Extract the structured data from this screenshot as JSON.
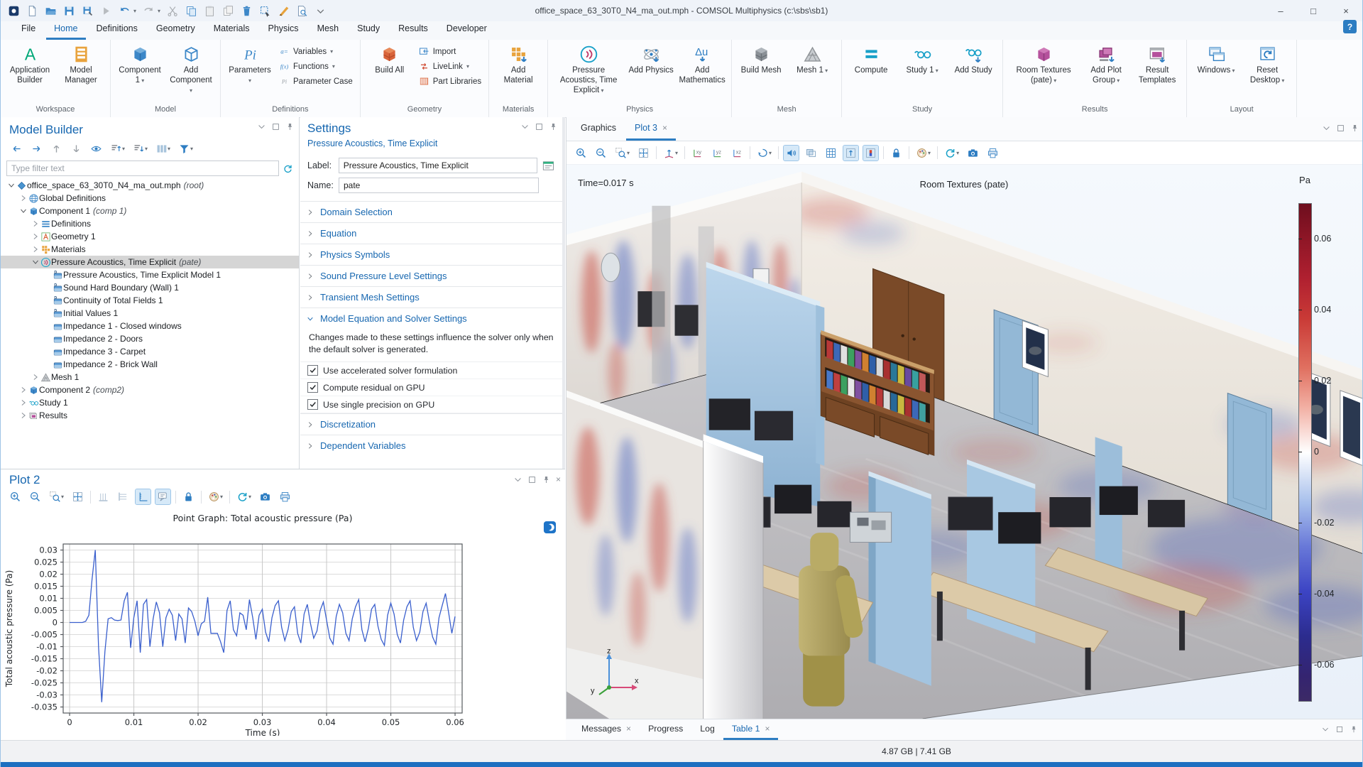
{
  "window": {
    "title": "office_space_63_30T0_N4_ma_out.mph - COMSOL Multiphysics (c:\\sbs\\sb1)",
    "controls": {
      "minimize": "–",
      "maximize": "□",
      "close": "×"
    },
    "quick_access_icons": [
      "app-logo",
      "new-doc",
      "open",
      "save",
      "save-as",
      "run",
      "undo",
      "redo",
      "cut",
      "copy",
      "paste",
      "duplicate",
      "delete",
      "select",
      "preview",
      "doc-search",
      "chev"
    ]
  },
  "menubar": {
    "items": [
      "File",
      "Home",
      "Definitions",
      "Geometry",
      "Materials",
      "Physics",
      "Mesh",
      "Study",
      "Results",
      "Developer"
    ],
    "active": "Home",
    "help_label": "?"
  },
  "ribbon": {
    "groups": [
      {
        "label": "Workspace",
        "big": [
          {
            "label": "Application Builder",
            "icon": "app-builder"
          },
          {
            "label": "Model Manager",
            "icon": "model-manager"
          }
        ]
      },
      {
        "label": "Model",
        "big": [
          {
            "label": "Component 1",
            "icon": "component",
            "dd": true
          },
          {
            "label": "Add Component",
            "icon": "add-component",
            "dd": true
          }
        ]
      },
      {
        "label": "Definitions",
        "big": [
          {
            "label": "Parameters",
            "icon": "parameters",
            "dd": true
          }
        ],
        "stack": [
          {
            "label": "Variables",
            "icon": "variables",
            "dd": true
          },
          {
            "label": "Functions",
            "icon": "functions",
            "dd": true
          },
          {
            "label": "Parameter Case",
            "icon": "param-case"
          }
        ]
      },
      {
        "label": "Geometry",
        "big": [
          {
            "label": "Build All",
            "icon": "build-all"
          }
        ],
        "stack": [
          {
            "label": "Import",
            "icon": "import"
          },
          {
            "label": "LiveLink",
            "icon": "livelink",
            "dd": true
          },
          {
            "label": "Part Libraries",
            "icon": "part-lib"
          }
        ]
      },
      {
        "label": "Materials",
        "big": [
          {
            "label": "Add Material",
            "icon": "add-material"
          }
        ]
      },
      {
        "label": "Physics",
        "big": [
          {
            "label": "Pressure Acoustics, Time Explicit",
            "icon": "acoustics",
            "dd": true,
            "wide": true
          },
          {
            "label": "Add Physics",
            "icon": "add-physics"
          },
          {
            "label": "Add Mathematics",
            "icon": "add-math"
          }
        ]
      },
      {
        "label": "Mesh",
        "big": [
          {
            "label": "Build Mesh",
            "icon": "build-mesh"
          },
          {
            "label": "Mesh 1",
            "icon": "mesh-node",
            "dd": true
          }
        ]
      },
      {
        "label": "Study",
        "big": [
          {
            "label": "Compute",
            "icon": "compute"
          },
          {
            "label": "Study 1",
            "icon": "study",
            "dd": true
          },
          {
            "label": "Add Study",
            "icon": "add-study"
          }
        ]
      },
      {
        "label": "Results",
        "big": [
          {
            "label": "Room Textures (pate)",
            "icon": "room-tex",
            "dd": true,
            "wide": true
          },
          {
            "label": "Add Plot Group",
            "icon": "add-plot",
            "dd": true
          },
          {
            "label": "Result Templates",
            "icon": "result-templates"
          }
        ]
      },
      {
        "label": "Layout",
        "big": [
          {
            "label": "Windows",
            "icon": "windows",
            "dd": true
          },
          {
            "label": "Reset Desktop",
            "icon": "reset-desktop",
            "dd": true
          }
        ]
      }
    ]
  },
  "model_builder": {
    "title": "Model Builder",
    "toolbar": [
      {
        "icon": "arrow-left"
      },
      {
        "icon": "arrow-right"
      },
      {
        "icon": "arrow-up"
      },
      {
        "icon": "arrow-down"
      },
      {
        "icon": "show"
      },
      {
        "icon": "collapse-list",
        "dd": true
      },
      {
        "icon": "expand-list",
        "dd": true
      },
      {
        "icon": "columns",
        "dd": true
      },
      {
        "icon": "filter",
        "dd": true
      }
    ],
    "filter_placeholder": "Type filter text",
    "tree": [
      {
        "depth": 0,
        "arrow": "down",
        "icon": "root-model",
        "label": "office_space_63_30T0_N4_ma_out.mph",
        "suffix": "(root)"
      },
      {
        "depth": 1,
        "arrow": "right",
        "icon": "global-definitions",
        "label": "Global Definitions"
      },
      {
        "depth": 1,
        "arrow": "down",
        "icon": "component-node",
        "label": "Component 1",
        "suffix": "(comp 1)"
      },
      {
        "depth": 2,
        "arrow": "right",
        "icon": "definitions-node",
        "label": "Definitions"
      },
      {
        "depth": 2,
        "arrow": "right",
        "icon": "geometry-node",
        "label": "Geometry 1"
      },
      {
        "depth": 2,
        "arrow": "right",
        "icon": "materials-node",
        "label": "Materials"
      },
      {
        "depth": 2,
        "arrow": "down",
        "icon": "acoustics-node",
        "label": "Pressure Acoustics, Time Explicit",
        "suffix": "(pate)",
        "selected": true
      },
      {
        "depth": 3,
        "arrow": "none",
        "icon": "d-boundary",
        "label": "Pressure Acoustics, Time Explicit Model 1"
      },
      {
        "depth": 3,
        "arrow": "none",
        "icon": "d-boundary",
        "label": "Sound Hard Boundary (Wall) 1"
      },
      {
        "depth": 3,
        "arrow": "none",
        "icon": "d-boundary",
        "label": "Continuity of Total Fields 1"
      },
      {
        "depth": 3,
        "arrow": "none",
        "icon": "d-boundary",
        "label": "Initial Values 1"
      },
      {
        "depth": 3,
        "arrow": "none",
        "icon": "boundary",
        "label": "Impedance 1 - Closed windows"
      },
      {
        "depth": 3,
        "arrow": "none",
        "icon": "boundary",
        "label": "Impedance 2 - Doors"
      },
      {
        "depth": 3,
        "arrow": "none",
        "icon": "boundary",
        "label": "Impedance 3 - Carpet"
      },
      {
        "depth": 3,
        "arrow": "none",
        "icon": "boundary",
        "label": "Impedance 2 - Brick Wall"
      },
      {
        "depth": 2,
        "arrow": "right",
        "icon": "mesh-node",
        "label": "Mesh 1"
      },
      {
        "depth": 1,
        "arrow": "right",
        "icon": "component-node",
        "label": "Component 2",
        "suffix": "(comp2)"
      },
      {
        "depth": 1,
        "arrow": "right",
        "icon": "study",
        "label": "Study 1"
      },
      {
        "depth": 1,
        "arrow": "right",
        "icon": "results-node",
        "label": "Results"
      }
    ]
  },
  "settings": {
    "title": "Settings",
    "subtitle": "Pressure Acoustics, Time Explicit",
    "label_caption": "Label:",
    "label_value": "Pressure Acoustics, Time Explicit",
    "name_caption": "Name:",
    "name_value": "pate",
    "sections": [
      {
        "label": "Domain Selection"
      },
      {
        "label": "Equation"
      },
      {
        "label": "Physics Symbols"
      },
      {
        "label": "Sound Pressure Level Settings"
      },
      {
        "label": "Transient Mesh Settings"
      },
      {
        "label": "Model Equation and Solver Settings",
        "expanded": true,
        "note": "Changes made to these settings influence the solver only when the default solver is generated.",
        "checkboxes": [
          {
            "label": "Use accelerated solver formulation",
            "checked": true
          },
          {
            "label": "Compute residual on GPU",
            "checked": true
          },
          {
            "label": "Use single precision on GPU",
            "checked": true
          }
        ]
      },
      {
        "label": "Discretization"
      },
      {
        "label": "Dependent Variables"
      }
    ]
  },
  "plot2": {
    "title": "Plot 2",
    "toolbar": [
      {
        "icon": "zoom-in"
      },
      {
        "icon": "zoom-out"
      },
      {
        "icon": "zoom-box",
        "dd": true
      },
      {
        "icon": "zoom-extents"
      },
      {
        "sep": true
      },
      {
        "icon": "x-grid"
      },
      {
        "icon": "y-grid"
      },
      {
        "icon": "y-axis",
        "active": true
      },
      {
        "icon": "annotation",
        "active": true
      },
      {
        "sep": true
      },
      {
        "icon": "lock"
      },
      {
        "sep": true
      },
      {
        "icon": "palette",
        "dd": true
      },
      {
        "sep": true
      },
      {
        "icon": "refresh",
        "dd": true
      },
      {
        "icon": "camera"
      },
      {
        "icon": "print"
      }
    ]
  },
  "graphics": {
    "tabs": [
      {
        "label": "Graphics"
      },
      {
        "label": "Plot 3",
        "active": true,
        "closable": true
      }
    ],
    "toolbar": [
      {
        "icon": "zoom-in"
      },
      {
        "icon": "zoom-out"
      },
      {
        "icon": "zoom-box",
        "dd": true
      },
      {
        "icon": "zoom-extents"
      },
      {
        "sep": true
      },
      {
        "icon": "axis-orientation",
        "dd": true
      },
      {
        "sep": true
      },
      {
        "icon": "view-xy"
      },
      {
        "icon": "view-yz"
      },
      {
        "icon": "view-xz"
      },
      {
        "sep": true
      },
      {
        "icon": "rotate",
        "dd": true
      },
      {
        "sep": true
      },
      {
        "icon": "speaker",
        "active": true
      },
      {
        "icon": "transparency"
      },
      {
        "icon": "grid"
      },
      {
        "icon": "scene-arrows",
        "active": true
      },
      {
        "icon": "color-legend",
        "active": true
      },
      {
        "sep": true
      },
      {
        "icon": "lock"
      },
      {
        "sep": true
      },
      {
        "icon": "palette",
        "dd": true
      },
      {
        "sep": true
      },
      {
        "icon": "refresh",
        "dd": true
      },
      {
        "icon": "camera"
      },
      {
        "icon": "print"
      }
    ]
  },
  "bottom_tabs": {
    "tabs": [
      {
        "label": "Messages",
        "closable": true
      },
      {
        "label": "Progress"
      },
      {
        "label": "Log"
      },
      {
        "label": "Table 1",
        "active": true,
        "closable": true
      }
    ]
  },
  "status": {
    "memory": "4.87 GB | 7.41 GB"
  },
  "colors": {
    "accent": "#2d7dc2",
    "header_blue": "#1767b0",
    "selection_gray": "#d5d5d5",
    "line_blue": "#3a5fcd"
  },
  "chart_data": [
    {
      "id": "point-graph",
      "type": "line",
      "title": "Point Graph: Total acoustic pressure (Pa)",
      "xlabel": "Time (s)",
      "ylabel": "Total acoustic pressure (Pa)",
      "xlim": [
        -0.001,
        0.0611
      ],
      "ylim": [
        -0.0375,
        0.0325
      ],
      "xticks": [
        0,
        0.01,
        0.02,
        0.03,
        0.04,
        0.05,
        0.06
      ],
      "yticks": [
        0.03,
        0.025,
        0.02,
        0.015,
        0.01,
        0.005,
        0,
        -0.005,
        -0.01,
        -0.015,
        -0.02,
        -0.025,
        -0.03,
        -0.035
      ],
      "grid": true,
      "legend": false,
      "line_color": "#3a5fcd",
      "t0": 0,
      "dt": 0.0005,
      "values": [
        0,
        0,
        0,
        0,
        0,
        0.0005,
        0.003,
        0.018,
        0.03,
        -0.01,
        -0.033,
        -0.012,
        0.0015,
        0.002,
        0.001,
        0.0008,
        0.001,
        0.009,
        0.0125,
        -0.0105,
        0.002,
        0.009,
        -0.0125,
        0.0075,
        0.0095,
        -0.01,
        0.0015,
        0.0085,
        0.004,
        -0.01,
        0.002,
        0.0055,
        0.003,
        -0.0075,
        0.0035,
        0.0015,
        -0.0085,
        0.006,
        0.0045,
        0.0005,
        -0.0055,
        -0.0005,
        0.0005,
        0.0105,
        -0.0045,
        -0.0045,
        -0.0045,
        -0.008,
        -0.0125,
        0.005,
        0.009,
        -0.003,
        -0.0055,
        0.004,
        0.003,
        -0.003,
        0.0095,
        0.002,
        -0.007,
        0.003,
        0.0055,
        -0.004,
        -0.008,
        0.002,
        0.007,
        0.009,
        -0.002,
        -0.0075,
        -0.003,
        0.0045,
        0.0065,
        -0.0045,
        -0.0085,
        0.0035,
        0.0075,
        -0.0005,
        -0.0065,
        -0.0035,
        0.005,
        0.0085,
        0.001,
        -0.0065,
        -0.009,
        0.0025,
        0.0075,
        0.004,
        -0.0045,
        -0.0075,
        0.0015,
        0.0065,
        0.0095,
        -0.003,
        -0.008,
        -0.0025,
        0.0055,
        0.0075,
        -0.0015,
        -0.007,
        -0.0095,
        0.003,
        0.008,
        0.0035,
        -0.005,
        -0.0085,
        0.001,
        0.0065,
        0.009,
        -0.002,
        -0.0075,
        -0.004,
        0.0045,
        0.008,
        0.0005,
        -0.006,
        -0.009,
        0.002,
        0.007,
        0.012,
        0.004,
        -0.0045,
        0.0025
      ]
    },
    {
      "id": "room-acoustics-3d",
      "type": "3d-surface",
      "title": "Room Textures (pate)",
      "time_label": "Time=0.017 s",
      "colorbar": {
        "unit": "Pa",
        "min": -0.07,
        "max": 0.07,
        "ticks": [
          0.06,
          0.04,
          0.02,
          0,
          -0.02,
          -0.04,
          -0.06
        ]
      }
    }
  ]
}
